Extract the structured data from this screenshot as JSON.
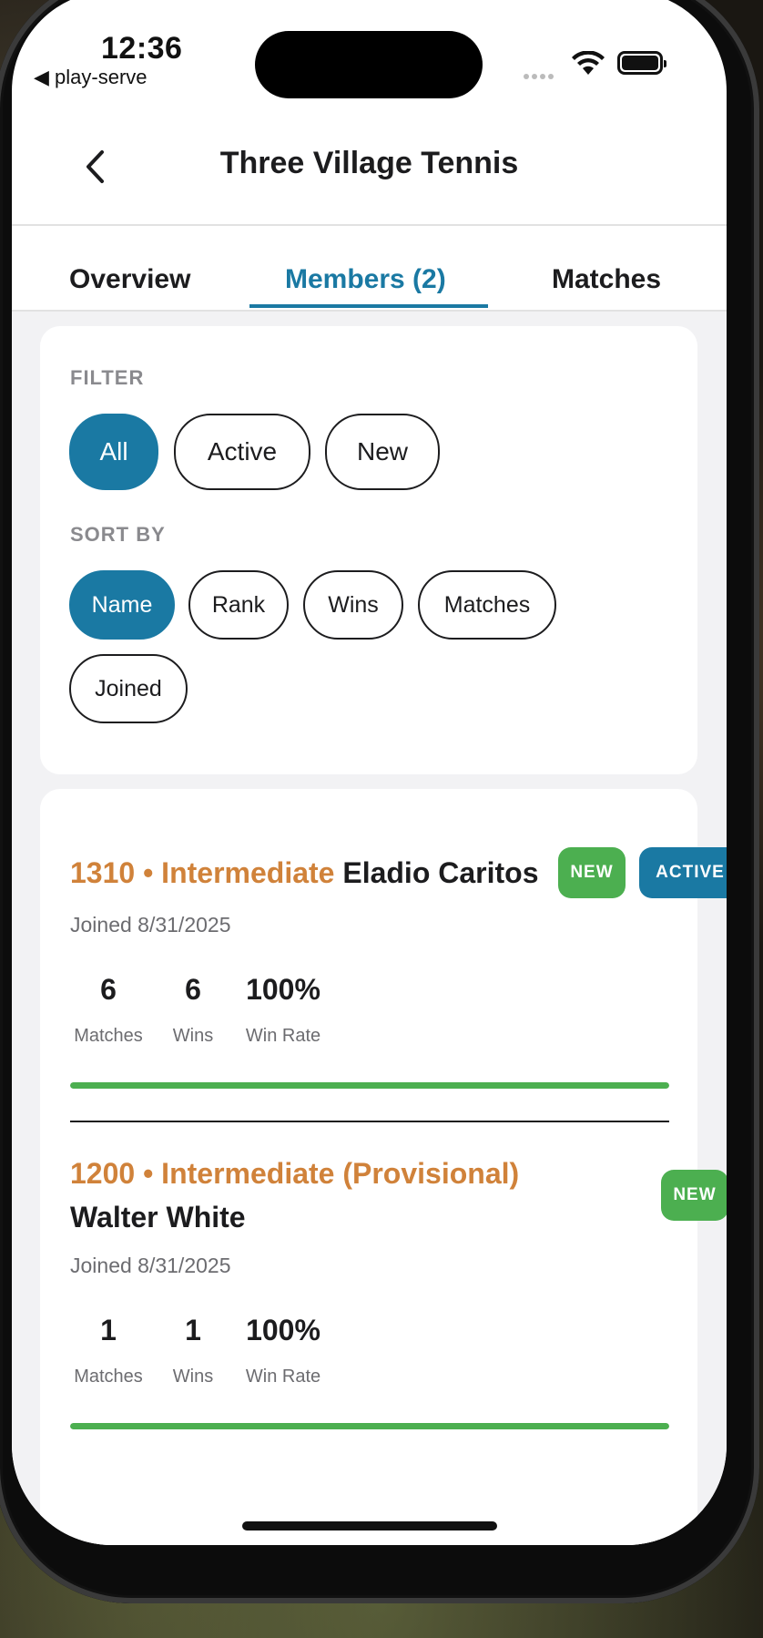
{
  "status_bar": {
    "time": "12:36",
    "back_app": "◀ play-serve"
  },
  "header": {
    "title": "Three Village Tennis"
  },
  "tabs": [
    {
      "label": "Overview",
      "active": false
    },
    {
      "label": "Members (2)",
      "active": true
    },
    {
      "label": "Matches",
      "active": false
    }
  ],
  "filter": {
    "label": "FILTER",
    "options": [
      "All",
      "Active",
      "New"
    ],
    "selected": "All"
  },
  "sort": {
    "label": "SORT BY",
    "options": [
      "Name",
      "Rank",
      "Wins",
      "Matches",
      "Joined"
    ],
    "selected": "Name"
  },
  "members": [
    {
      "rating_level": "1310 • Intermediate",
      "name": "Eladio Caritos",
      "badges": [
        "NEW",
        "ACTIVE"
      ],
      "joined": "Joined 8/31/2025",
      "matches": "6",
      "matches_label": "Matches",
      "wins": "6",
      "wins_label": "Wins",
      "win_rate": "100%",
      "win_rate_label": "Win Rate",
      "win_rate_fraction": 1.0
    },
    {
      "rating_level": "1200 • Intermediate (Provisional)",
      "name": "Walter White",
      "badges": [
        "NEW"
      ],
      "joined": "Joined 8/31/2025",
      "matches": "1",
      "matches_label": "Matches",
      "wins": "1",
      "wins_label": "Wins",
      "win_rate": "100%",
      "win_rate_label": "Win Rate",
      "win_rate_fraction": 1.0
    }
  ],
  "colors": {
    "accent": "#1a79a3",
    "level": "#d0823a",
    "success": "#4caf50"
  }
}
